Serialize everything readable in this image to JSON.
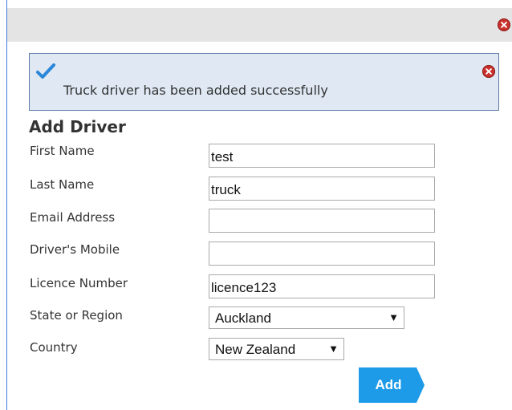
{
  "alert": {
    "message": "Truck driver has been added successfully"
  },
  "form": {
    "title": "Add Driver",
    "fields": [
      {
        "label": "First Name",
        "value": "test"
      },
      {
        "label": "Last Name",
        "value": "truck"
      },
      {
        "label": "Email Address",
        "value": ""
      },
      {
        "label": "Driver's Mobile",
        "value": ""
      },
      {
        "label": "Licence Number",
        "value": "licence123"
      }
    ],
    "state": {
      "label": "State or Region",
      "selected": "Auckland"
    },
    "country": {
      "label": "Country",
      "selected": "New Zealand"
    },
    "add_label": "Add"
  },
  "colors": {
    "accent": "#1e9be8",
    "alert_bg": "#dfe8f3",
    "close_red": "#c9302c"
  },
  "icons": [
    "close-icon",
    "check-icon",
    "chevron-down-icon"
  ]
}
